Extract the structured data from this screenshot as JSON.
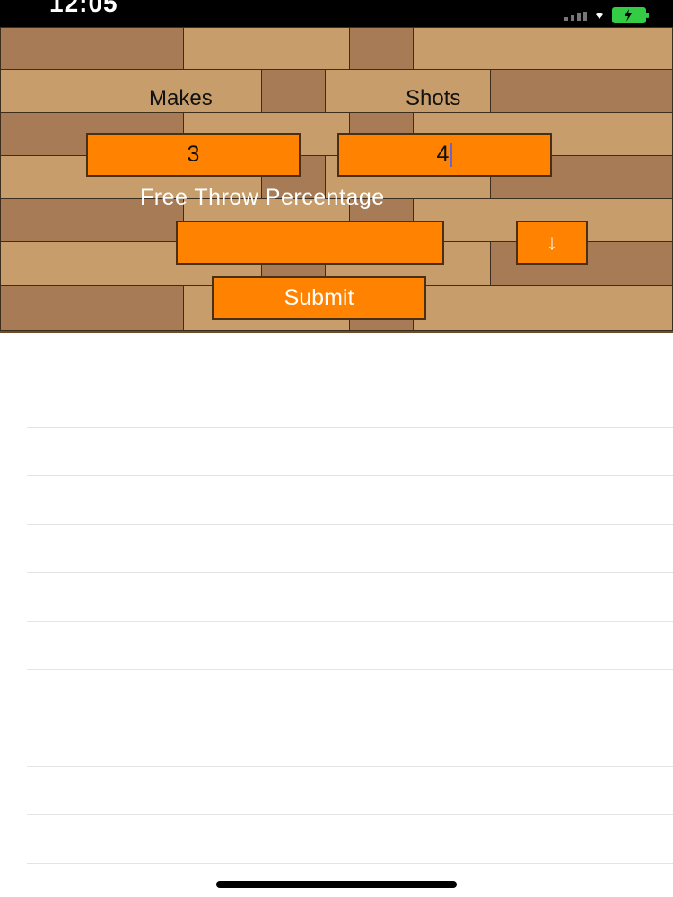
{
  "status_bar": {
    "time": "12:05",
    "icons": [
      "signal-icon",
      "wifi-icon",
      "battery-icon"
    ],
    "battery_color": "#33cc44"
  },
  "form": {
    "makes_label": "Makes",
    "shots_label": "Shots",
    "makes_value": "3",
    "shots_value": "4",
    "free_throw_percentage_label": "Free Throw Percentage",
    "percentage_value": "",
    "down_button_label": "↓",
    "submit_label": "Submit"
  },
  "list": {
    "rows": [
      "",
      "",
      "",
      "",
      "",
      "",
      "",
      "",
      "",
      "",
      ""
    ]
  },
  "colors": {
    "accent": "#ff8300",
    "wood_light": "#c79d6b",
    "wood_dark": "#a67b55",
    "plank_border": "#3c2d1c"
  }
}
